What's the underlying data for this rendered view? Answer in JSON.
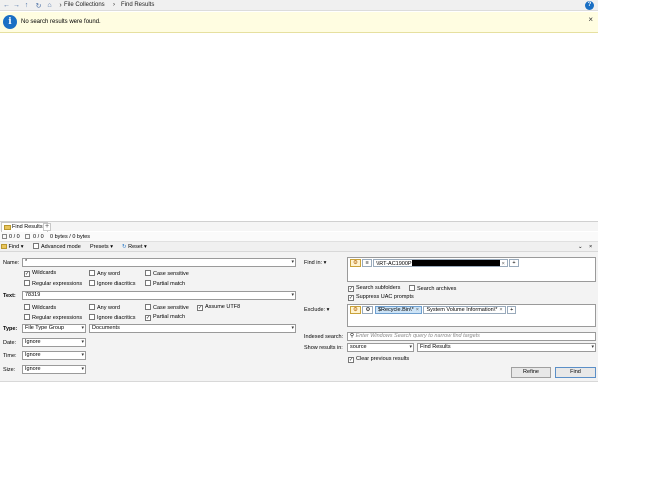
{
  "nav": {
    "breadcrumbs": [
      "File Collections",
      "Find Results"
    ],
    "help_glyph": "?"
  },
  "info": {
    "message": "No search results were found.",
    "close_glyph": "×",
    "icon": "info-icon"
  },
  "tabs": {
    "items": [
      {
        "label": "Find Results"
      }
    ],
    "add_glyph": "+"
  },
  "status": {
    "count_a": "0 / 0",
    "count_b": "0 / 0",
    "size": "0 bytes / 0 bytes"
  },
  "toolbar": {
    "find_label": "Find",
    "advanced_label": "Advanced mode",
    "advanced_checked": false,
    "presets_label": "Presets",
    "reset_label": "Reset"
  },
  "search": {
    "name_label": "Name:",
    "name_value": "*",
    "name_options": [
      {
        "label": "Wildcards",
        "checked": true
      },
      {
        "label": "Any word",
        "checked": false
      },
      {
        "label": "Case sensitive",
        "checked": false
      },
      {
        "label": "Regular expressions",
        "checked": false
      },
      {
        "label": "Ignore diacritics",
        "checked": false
      },
      {
        "label": "Partial match",
        "checked": false
      }
    ],
    "text_label": "Text:",
    "text_value": "78319",
    "text_options": [
      {
        "label": "Wildcards",
        "checked": false
      },
      {
        "label": "Any word",
        "checked": false
      },
      {
        "label": "Case sensitive",
        "checked": false
      },
      {
        "label": "Assume UTF8",
        "checked": true
      },
      {
        "label": "Regular expressions",
        "checked": false
      },
      {
        "label": "Ignore diacritics",
        "checked": false
      },
      {
        "label": "Partial match",
        "checked": true
      }
    ],
    "type_label": "Type:",
    "type_value": "File Type Group",
    "type_group_value": "Documents",
    "date_label": "Date:",
    "date_value": "Ignore",
    "time_label": "Time:",
    "time_value": "Ignore",
    "size_label": "Size:",
    "size_value": "Ignore"
  },
  "location": {
    "find_in_label": "Find in:",
    "find_in_path": "\\\\RT-AC1900P",
    "search_subfolders": {
      "label": "Search subfolders",
      "checked": true
    },
    "search_archives": {
      "label": "Search archives",
      "checked": false
    },
    "suppress_uac": {
      "label": "Suppress UAC prompts",
      "checked": true
    },
    "exclude_label": "Exclude:",
    "exclude_items": [
      "$Recycle.Bin\\*",
      "System Volume Information\\*"
    ],
    "indexed_label": "Indexed search:",
    "indexed_placeholder": "Enter Windows Search query to narrow find targets",
    "show_results_label": "Show results in:",
    "show_results_value": "source",
    "results_target_value": "Find Results",
    "clear_previous": {
      "label": "Clear previous results",
      "checked": true
    },
    "refine_label": "Refine",
    "find_button_label": "Find"
  },
  "colors": {
    "info_bg": "#fffde1",
    "accent": "#1a6fc4",
    "chip_selected": "#cde4f7"
  }
}
